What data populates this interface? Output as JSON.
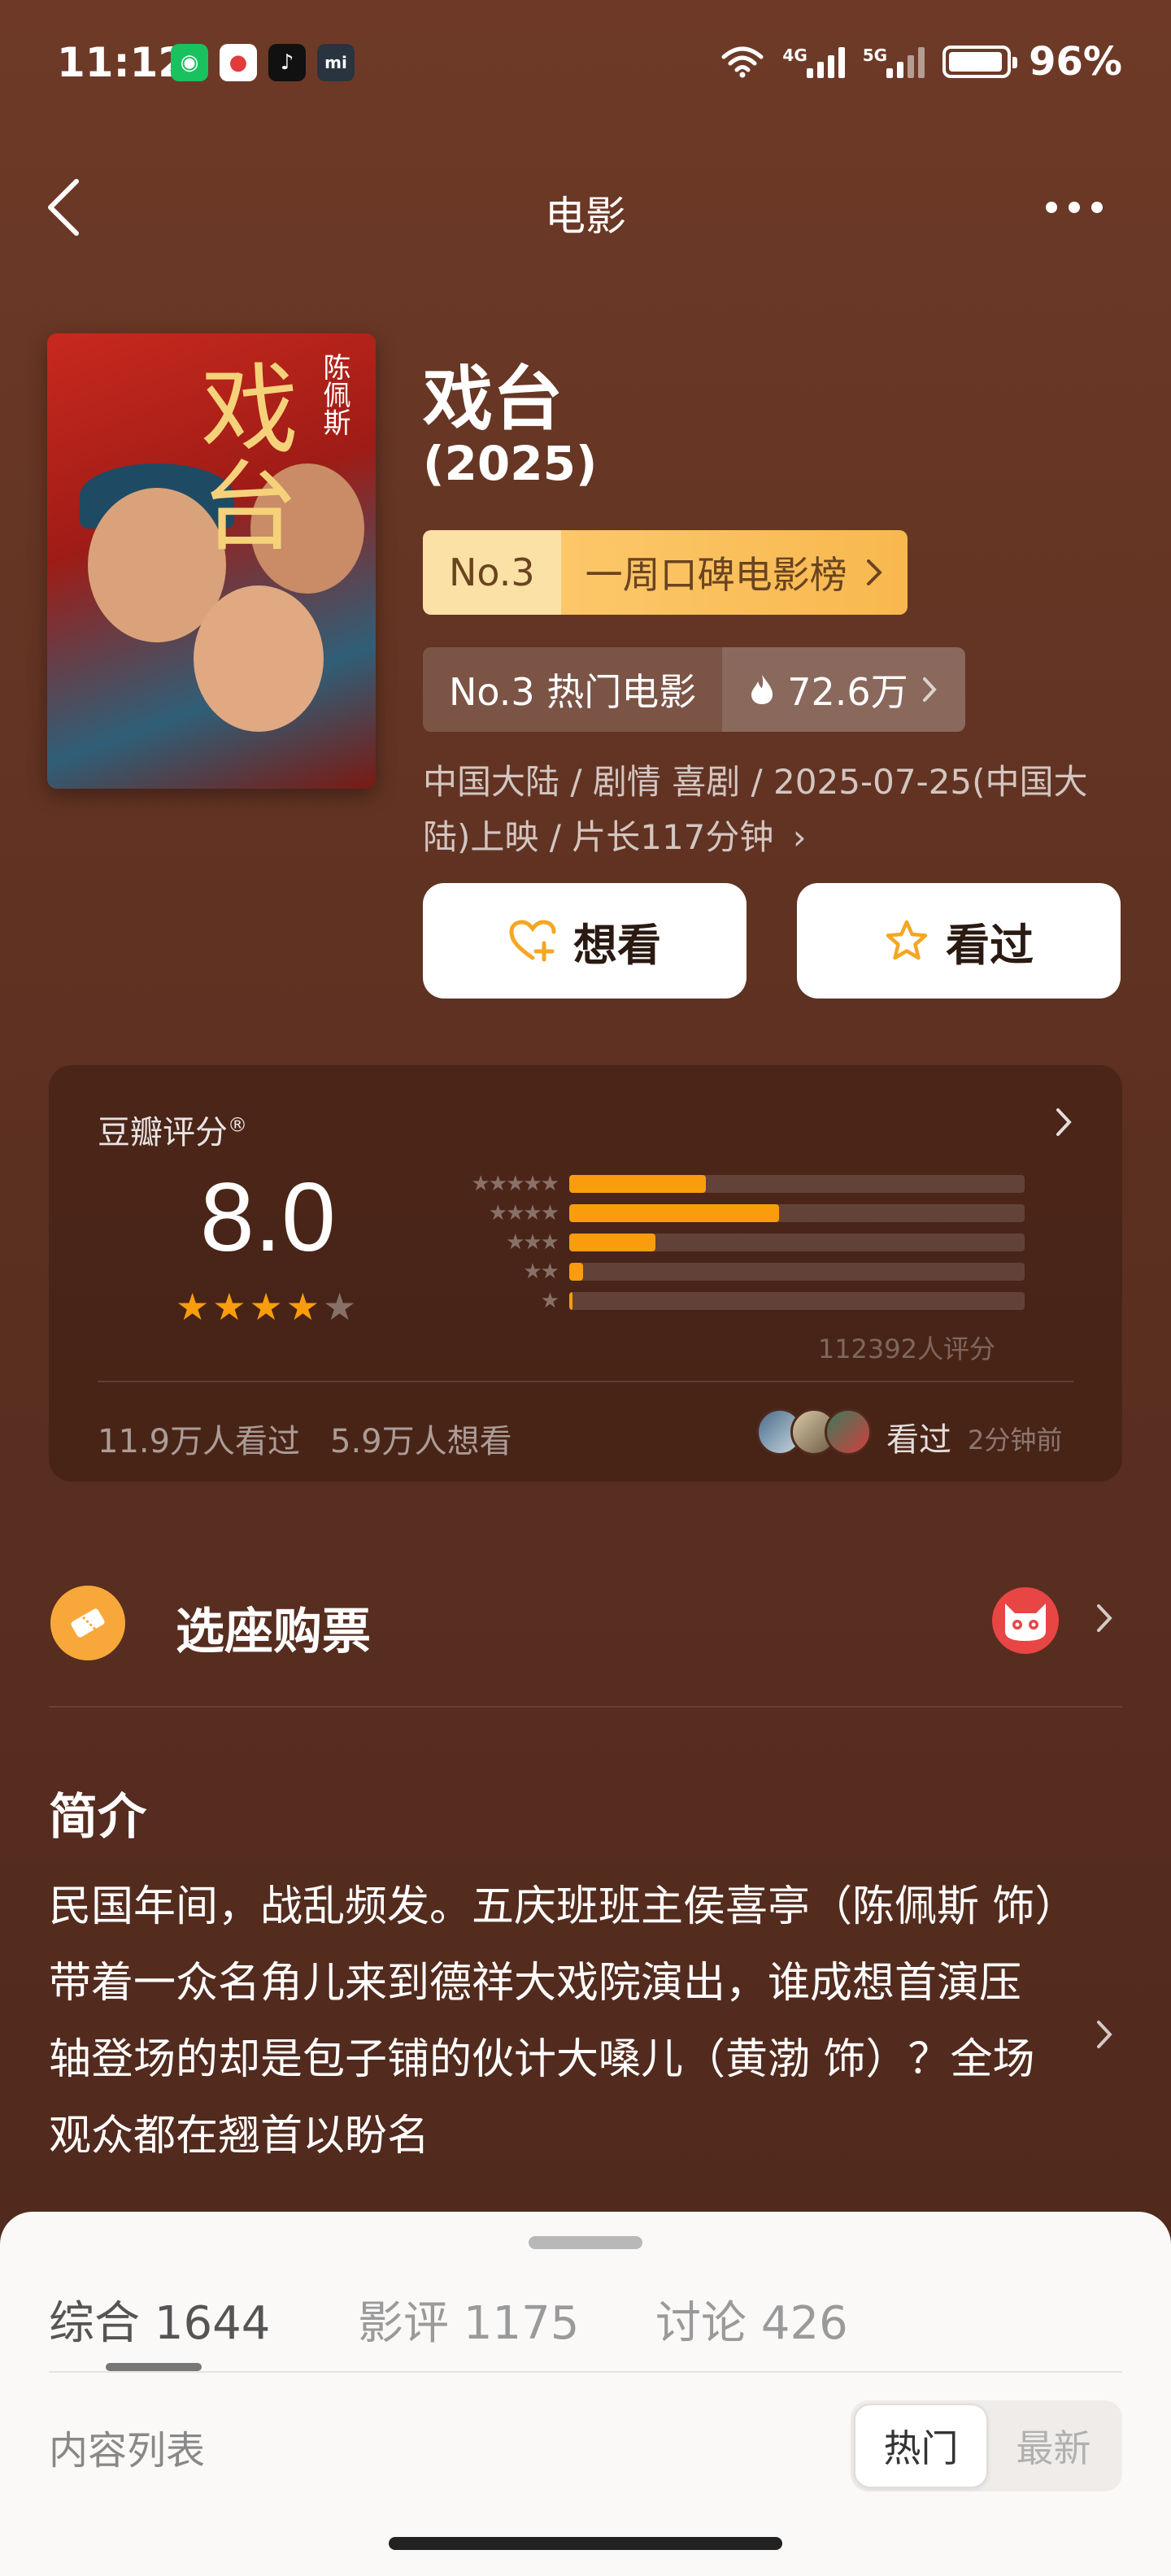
{
  "status_bar": {
    "time": "11:12",
    "app_icons": [
      "wechat-icon",
      "app-red-icon",
      "tiktok-icon",
      "mi-icon"
    ],
    "net1": "4G",
    "net2": "5G",
    "battery": "96%",
    "battery_level": 0.96
  },
  "nav": {
    "title": "电影"
  },
  "movie": {
    "title": "戏台",
    "year": "(2025)",
    "rank1_no": "No.3",
    "rank1_list": "一周口碑电影榜",
    "rank2_label": "No.3 热门电影",
    "rank2_heat": "72.6万",
    "meta": "中国大陆 / 剧情 喜剧 / 2025-07-25(中国大陆)上映 / 片长117分钟",
    "poster_title": "戏台",
    "poster_cast": "陈佩斯"
  },
  "actions": {
    "want": "想看",
    "seen": "看过"
  },
  "rating": {
    "label": "豆瓣评分",
    "mark": "®",
    "score": "8.0",
    "stars_value": 4,
    "votes": "112392人评分",
    "seen_count": "11.9万人看过",
    "want_count": "5.9万人想看",
    "friends_action": "看过",
    "friends_time": "2分钟前",
    "distribution": [
      {
        "stars": "★★★★★",
        "fraction": 0.3
      },
      {
        "stars": "★★★★",
        "fraction": 0.46
      },
      {
        "stars": "★★★",
        "fraction": 0.19
      },
      {
        "stars": "★★",
        "fraction": 0.03
      },
      {
        "stars": "★",
        "fraction": 0.008
      }
    ],
    "colors": {
      "accent": "#fa9d0c"
    }
  },
  "ticket": {
    "label": "选座购票"
  },
  "synopsis": {
    "title": "简介",
    "text": "民国年间，战乱频发。五庆班班主侯喜亭（陈佩斯 饰）带着一众名角儿来到德祥大戏院演出，谁成想首演压轴登场的却是包子铺的伙计大嗓儿（黄渤 饰）？全场观众都在翘首以盼名"
  },
  "sheet": {
    "tabs": [
      {
        "label": "综合",
        "count": "1644"
      },
      {
        "label": "影评",
        "count": "1175"
      },
      {
        "label": "讨论",
        "count": "426"
      }
    ],
    "list_label": "内容列表",
    "sort_options": [
      "热门",
      "最新"
    ]
  }
}
